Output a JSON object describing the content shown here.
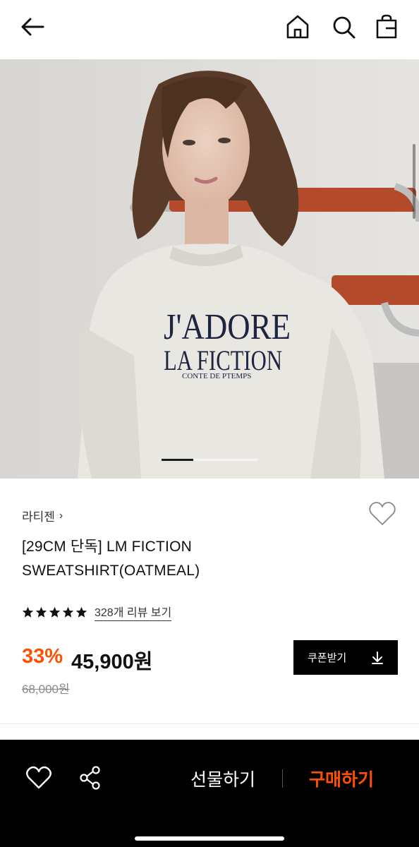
{
  "header": {
    "back_icon": "arrow-left-icon",
    "home_icon": "home-icon",
    "search_icon": "search-icon",
    "bag_icon": "shopping-bag-icon"
  },
  "hero": {
    "image_text_line1": "J'ADORE",
    "image_text_line2": "LA FICTION",
    "image_text_line3": "CONTE DE PTEMPS",
    "pager_current": 1,
    "pager_total": 3
  },
  "product": {
    "brand": "라티젠",
    "brand_chevron": "›",
    "title_line1": "[29CM 단독] LM FICTION",
    "title_line2": "SWEATSHIRT(OATMEAL)",
    "rating_stars": 5,
    "review_link": "328개 리뷰 보기",
    "discount": "33%",
    "price": "45,900원",
    "original_price": "68,000원",
    "coupon_label": "쿠폰받기"
  },
  "bottom_bar": {
    "gift_label": "선물하기",
    "buy_label": "구매하기"
  },
  "colors": {
    "accent": "#ff4f00",
    "bar_bg": "#000000"
  }
}
